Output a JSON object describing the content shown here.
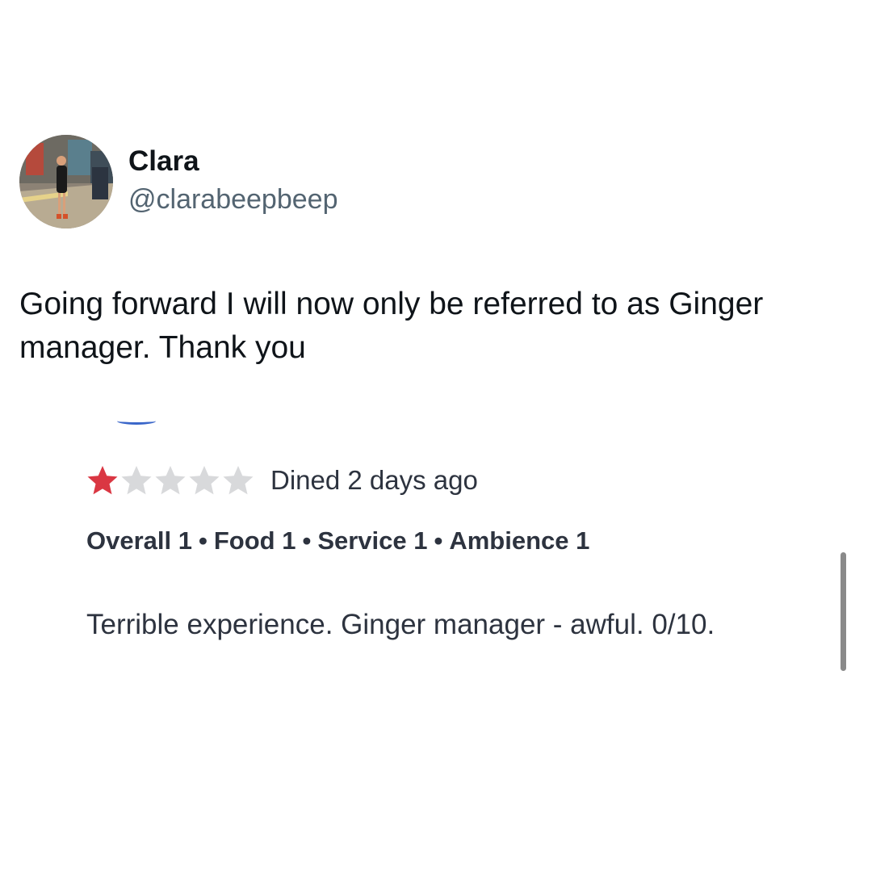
{
  "tweet": {
    "display_name": "Clara",
    "handle": "@clarabeepbeep",
    "text": "Going forward I will now only be referred to as Ginger manager. Thank you"
  },
  "review": {
    "rating": 1,
    "max_rating": 5,
    "star_filled_color": "#da3743",
    "star_empty_color": "#d8d9db",
    "dined": "Dined 2 days ago",
    "scores": [
      {
        "label": "Overall 1"
      },
      {
        "label": "Food 1"
      },
      {
        "label": "Service 1"
      },
      {
        "label": "Ambience 1"
      }
    ],
    "separator": "•",
    "body": "Terrible experience. Ginger manager - awful. 0/10."
  }
}
